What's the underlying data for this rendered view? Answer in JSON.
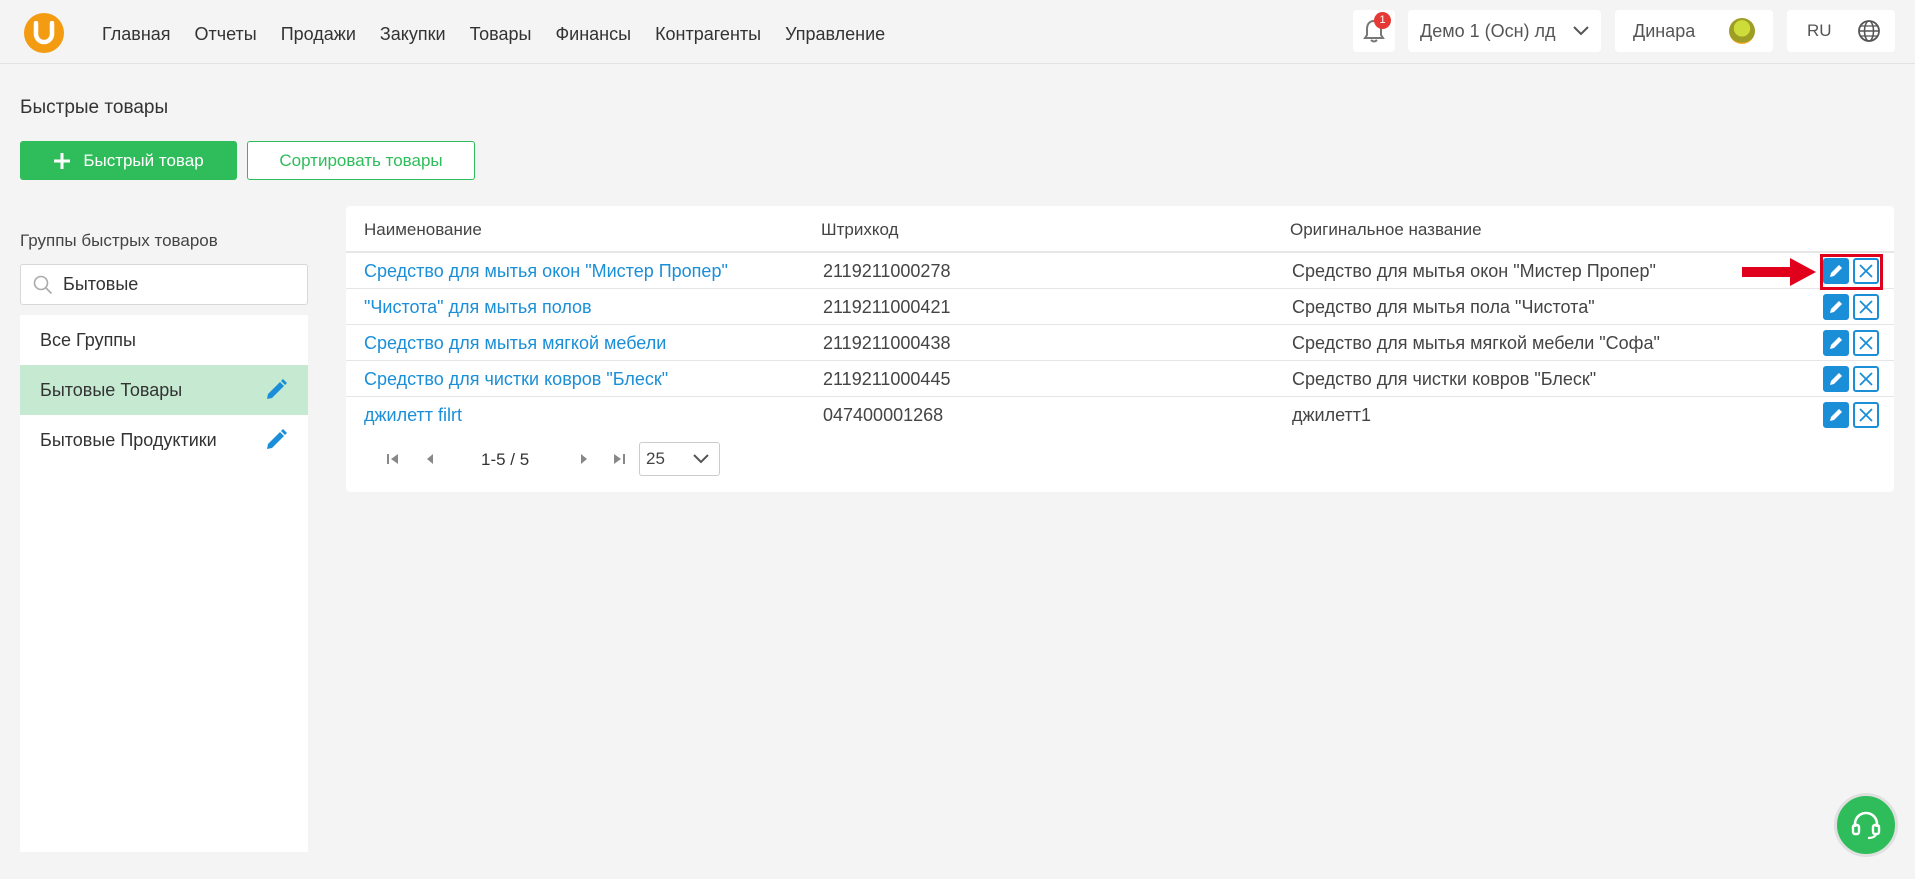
{
  "nav": {
    "items": [
      "Главная",
      "Отчеты",
      "Продажи",
      "Закупки",
      "Товары",
      "Финансы",
      "Контрагенты",
      "Управление"
    ]
  },
  "header": {
    "notifications_count": "1",
    "company": "Демо 1 (Осн) лд",
    "user": "Динара",
    "language": "RU"
  },
  "page": {
    "title": "Быстрые товары",
    "add_button": "Быстрый товар",
    "sort_button": "Сортировать товары"
  },
  "groups": {
    "title": "Группы быстрых товаров",
    "search_value": "Бытовые",
    "items": [
      {
        "label": "Все Группы",
        "active": false,
        "editable": false
      },
      {
        "label": "Бытовые Товары",
        "active": true,
        "editable": true
      },
      {
        "label": "Бытовые Продуктики",
        "active": false,
        "editable": true
      }
    ]
  },
  "table": {
    "columns": [
      "Наименование",
      "Штрихкод",
      "Оригинальное название"
    ],
    "rows": [
      {
        "name": "Средство для мытья окон \"Мистер Пропер\"",
        "barcode": "2119211000278",
        "original": "Средство для мытья окон \"Мистер Пропер\""
      },
      {
        "name": "\"Чистота\" для мытья полов",
        "barcode": "2119211000421",
        "original": "Средство для мытья пола \"Чистота\""
      },
      {
        "name": "Средство для мытья мягкой мебели",
        "barcode": "2119211000438",
        "original": "Средство для мытья мягкой мебели \"Софа\""
      },
      {
        "name": "Средство для чистки ковров \"Блеск\"",
        "barcode": "2119211000445",
        "original": "Средство для чистки ковров \"Блеск\""
      },
      {
        "name": "джилетт filrt",
        "barcode": "047400001268",
        "original": "джилетт1"
      }
    ]
  },
  "pagination": {
    "range": "1-5 / 5",
    "page_size": "25"
  },
  "colors": {
    "accent_green": "#2ebd5a",
    "link_blue": "#1a8fd8",
    "highlight_red": "#e0001b",
    "logo_orange": "#f39c12"
  }
}
